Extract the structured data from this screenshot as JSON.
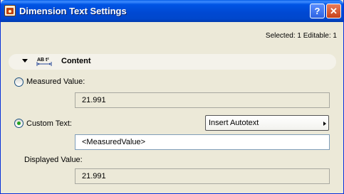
{
  "window": {
    "title": "Dimension Text Settings",
    "help_label": "?",
    "close_label": "✕"
  },
  "selection_info": "Selected: 1 Editable: 1",
  "section": {
    "icon_label": "AB t²",
    "title": "Content"
  },
  "measured": {
    "label": "Measured Value:",
    "value": "21.991",
    "checked": false
  },
  "custom": {
    "label": "Custom Text:",
    "value": "<MeasuredValue>",
    "checked": true
  },
  "autotext": {
    "label": "Insert Autotext"
  },
  "displayed": {
    "label": "Displayed Value:",
    "value": "21.991"
  },
  "colors": {
    "titlebar": "#0055e5",
    "dialog_bg": "#ece9d8",
    "radio_dot": "#21a121"
  }
}
